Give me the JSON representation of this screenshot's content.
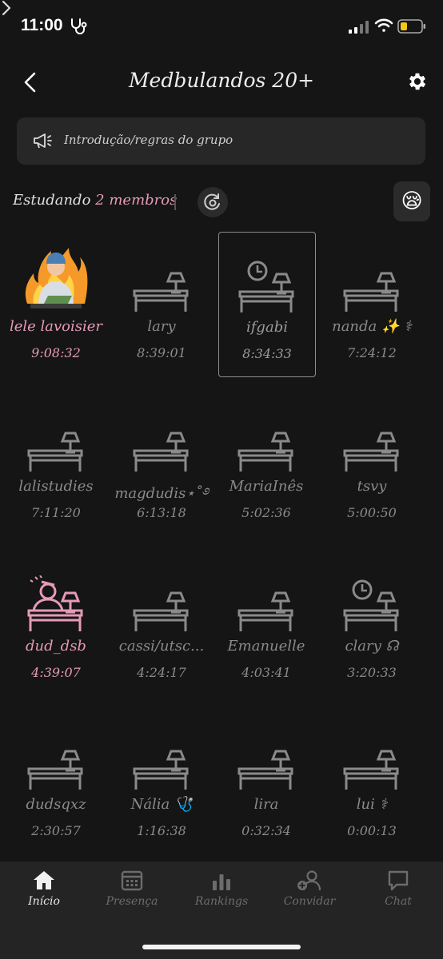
{
  "status_bar": {
    "time": "11:00",
    "icons": [
      "stethoscope-icon",
      "signal-icon",
      "wifi-icon",
      "battery-icon"
    ]
  },
  "header": {
    "title": "Medbulandos 20+"
  },
  "rules": {
    "label": "Introdução/regras do grupo"
  },
  "studying": {
    "prefix": "Estudando",
    "count": "2",
    "members": "membros",
    "mood_emoji": "😪"
  },
  "colors": {
    "accent": "#e59ab8",
    "background": "#151515",
    "muted": "#8a8a8a"
  },
  "members": [
    {
      "name": "lele lavoisier",
      "time": "9:08:32",
      "state": "active",
      "icon": "doctor-avatar-icon"
    },
    {
      "name": "lary",
      "time": "8:39:01",
      "state": "idle",
      "icon": "desk-lamp-icon"
    },
    {
      "name": "ifgabi",
      "time": "8:34:33",
      "state": "selected",
      "icon": "desk-clock-icon"
    },
    {
      "name": "nanda ✨ ⚕",
      "time": "7:24:12",
      "state": "idle",
      "icon": "desk-lamp-icon"
    },
    {
      "name": "lalistudies",
      "time": "7:11:20",
      "state": "idle",
      "icon": "desk-lamp-icon"
    },
    {
      "name": "magdudis⋆˚࿔",
      "time": "6:13:18",
      "state": "idle",
      "icon": "desk-lamp-icon"
    },
    {
      "name": "MariaInês",
      "time": "5:02:36",
      "state": "idle",
      "icon": "desk-lamp-icon"
    },
    {
      "name": "tsvy",
      "time": "5:00:50",
      "state": "idle",
      "icon": "desk-lamp-icon"
    },
    {
      "name": "dud_dsb",
      "time": "4:39:07",
      "state": "active",
      "icon": "studying-person-icon"
    },
    {
      "name": "cassi/utsc...",
      "time": "4:24:17",
      "state": "idle",
      "icon": "desk-lamp-icon"
    },
    {
      "name": "Emanuelle",
      "time": "4:03:41",
      "state": "idle",
      "icon": "desk-lamp-icon"
    },
    {
      "name": "clary ☊",
      "time": "3:20:33",
      "state": "idle",
      "icon": "desk-clock-icon"
    },
    {
      "name": "dudsqxz",
      "time": "2:30:57",
      "state": "idle",
      "icon": "desk-lamp-icon"
    },
    {
      "name": "Nália 🩺",
      "time": "1:16:38",
      "state": "idle",
      "icon": "desk-lamp-icon"
    },
    {
      "name": "lira",
      "time": "0:32:34",
      "state": "idle",
      "icon": "desk-lamp-icon"
    },
    {
      "name": "lui ⚕",
      "time": "0:00:13",
      "state": "idle",
      "icon": "desk-lamp-icon"
    }
  ],
  "nav": [
    {
      "label": "Início",
      "icon": "home-icon",
      "active": true
    },
    {
      "label": "Presença",
      "icon": "calendar-icon",
      "active": false
    },
    {
      "label": "Rankings",
      "icon": "bar-chart-icon",
      "active": false
    },
    {
      "label": "Convidar",
      "icon": "add-user-icon",
      "active": false
    },
    {
      "label": "Chat",
      "icon": "chat-icon",
      "active": false
    }
  ]
}
